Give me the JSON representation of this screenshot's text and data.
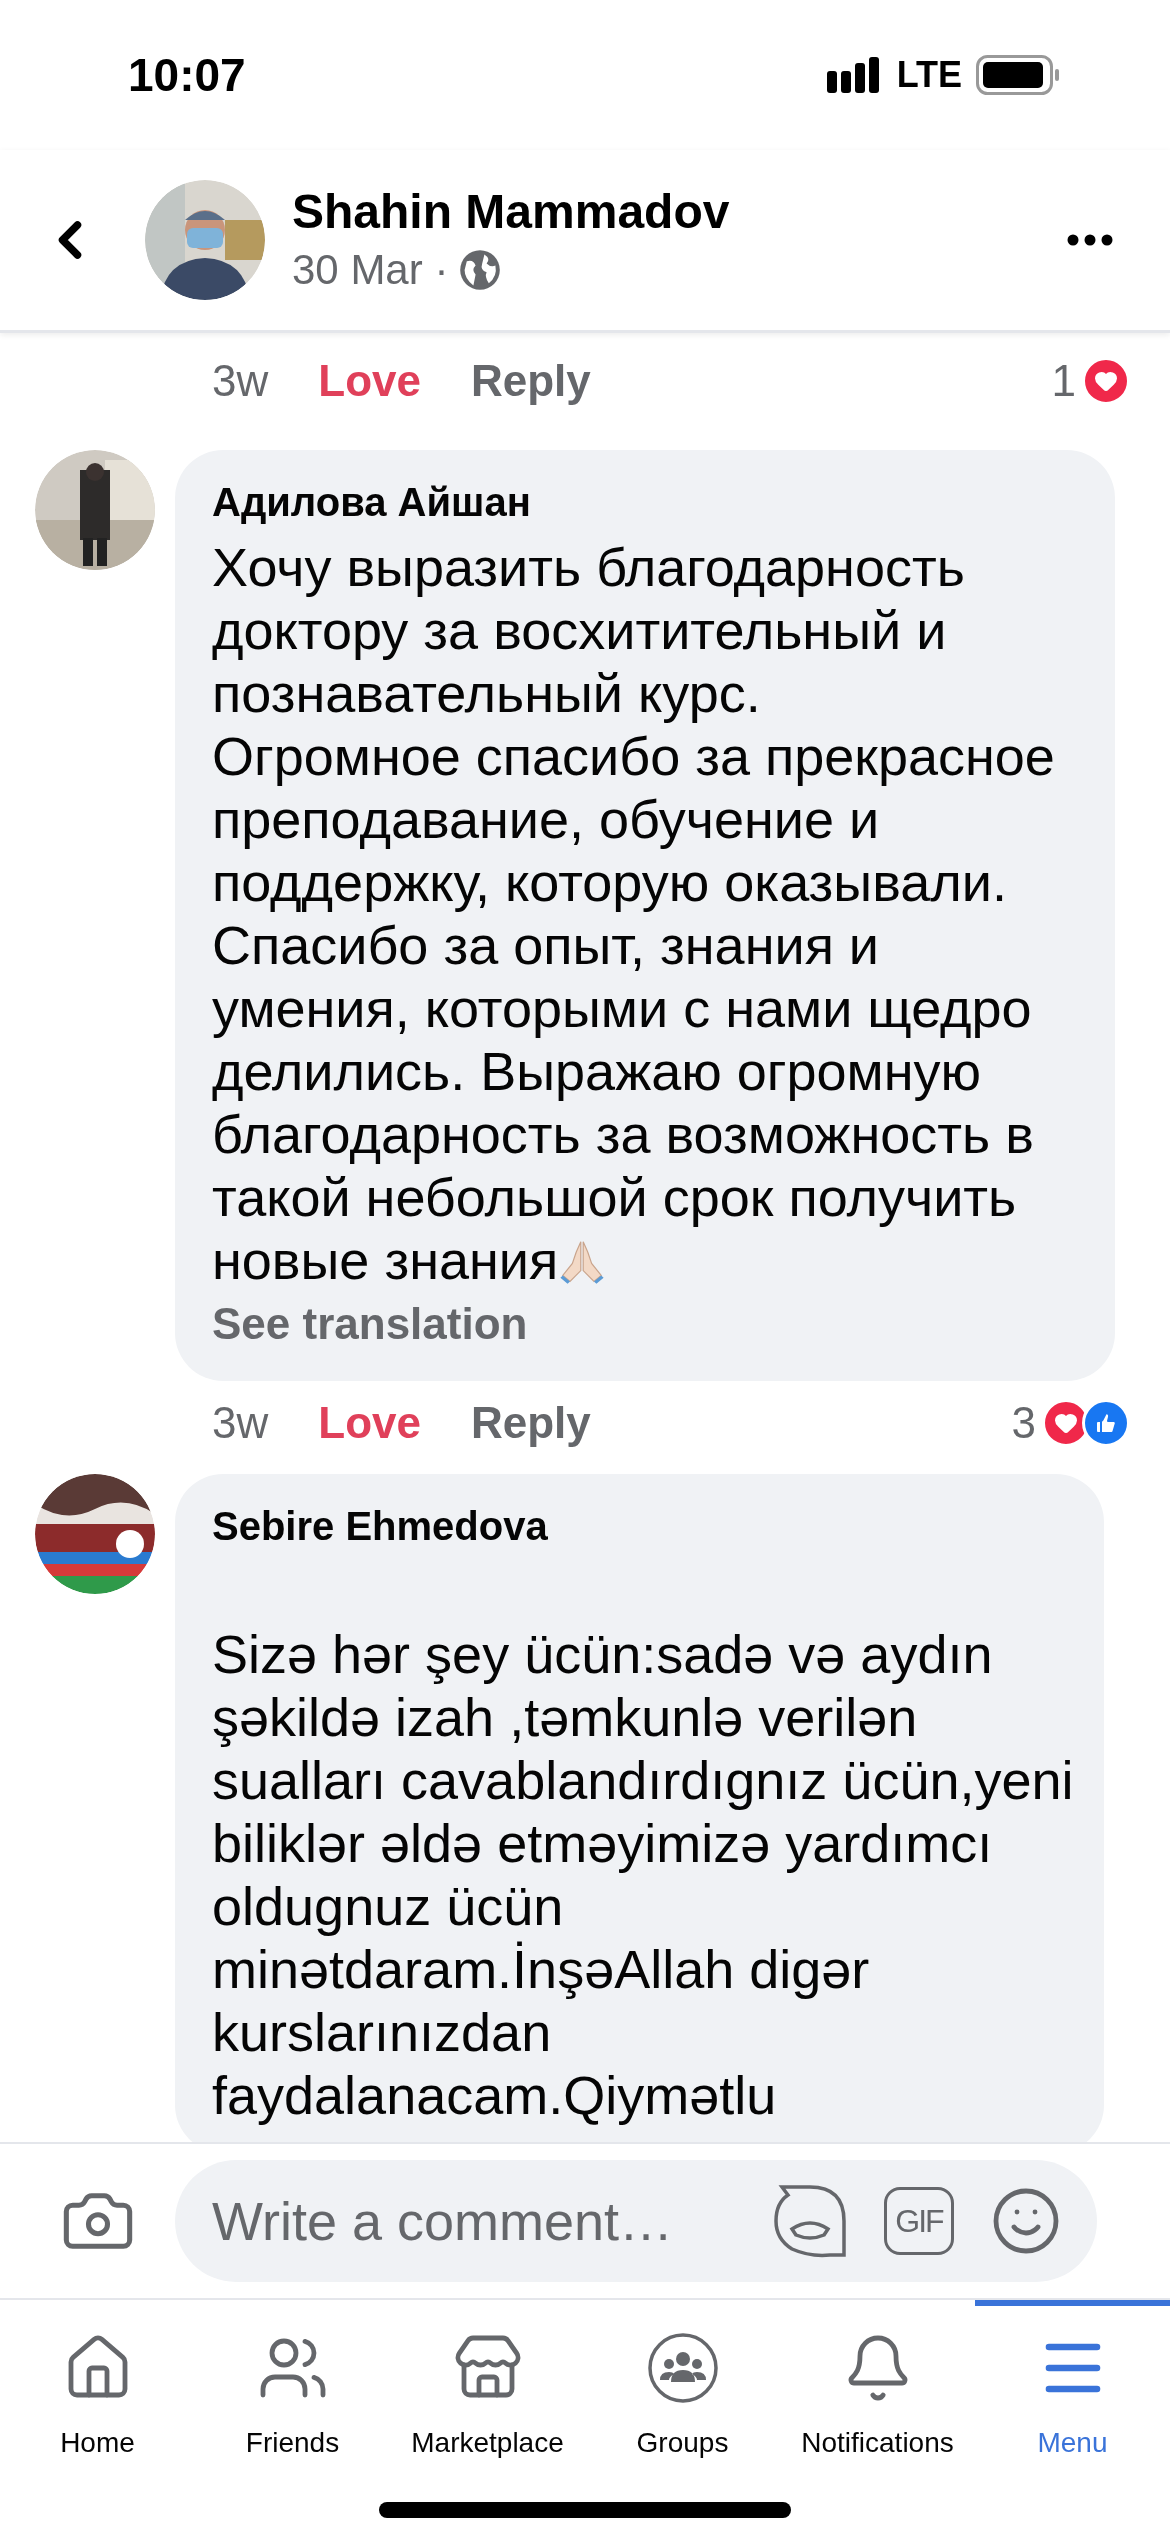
{
  "status_bar": {
    "time": "10:07",
    "network": "LTE"
  },
  "header": {
    "name": "Shahin Mammadov",
    "date": "30 Mar ·"
  },
  "top_actions": {
    "time": "3w",
    "love": "Love",
    "reacted": true,
    "reply": "Reply",
    "count": "1",
    "reactions": [
      {
        "kind": "love"
      }
    ]
  },
  "comments": [
    {
      "author": "Адилова Айшан",
      "body": "Хочу выразить благодарность доктору за восхитительный и познавательный курс.\nОгромное спасибо за прекрасное преподавание, обучение и поддержку, которую оказывали. Спасибо за опыт, знания и умения, которыми с нами щедро делились. Выражаю огромную благодарность за возможность в такой небольшой срок получить новые знания",
      "praying_hands_emoji": true,
      "see_translation": "See translation",
      "actions": {
        "time": "3w",
        "love": "Love",
        "reacted": true,
        "reply": "Reply",
        "count": "3",
        "reactions": [
          {
            "kind": "love"
          },
          {
            "kind": "like"
          }
        ]
      }
    },
    {
      "author": "Sebire Ehmedova",
      "body": "\nSizə hər şey ücün:sadə və aydın şəkildə izah ,təmkunlə verilən sualları cavablandırdıgnız ücün,yeni biliklər əldə etməyimizə yardımcı oldugnuz ücün minətdaram.İnşəAllah digər kurslarınızdan faydalanacam.Qiymətlu"
    }
  ],
  "composer": {
    "placeholder": "Write a comment…",
    "gif": "GIF"
  },
  "tabs": [
    {
      "label": "Home",
      "kind": "home",
      "selected": false
    },
    {
      "label": "Friends",
      "kind": "friends",
      "selected": false
    },
    {
      "label": "Marketplace",
      "kind": "marketplace",
      "selected": false
    },
    {
      "label": "Groups",
      "kind": "groups",
      "selected": false
    },
    {
      "label": "Notifications",
      "kind": "notifications",
      "selected": false
    },
    {
      "label": "Menu",
      "kind": "menu",
      "selected": true
    }
  ]
}
